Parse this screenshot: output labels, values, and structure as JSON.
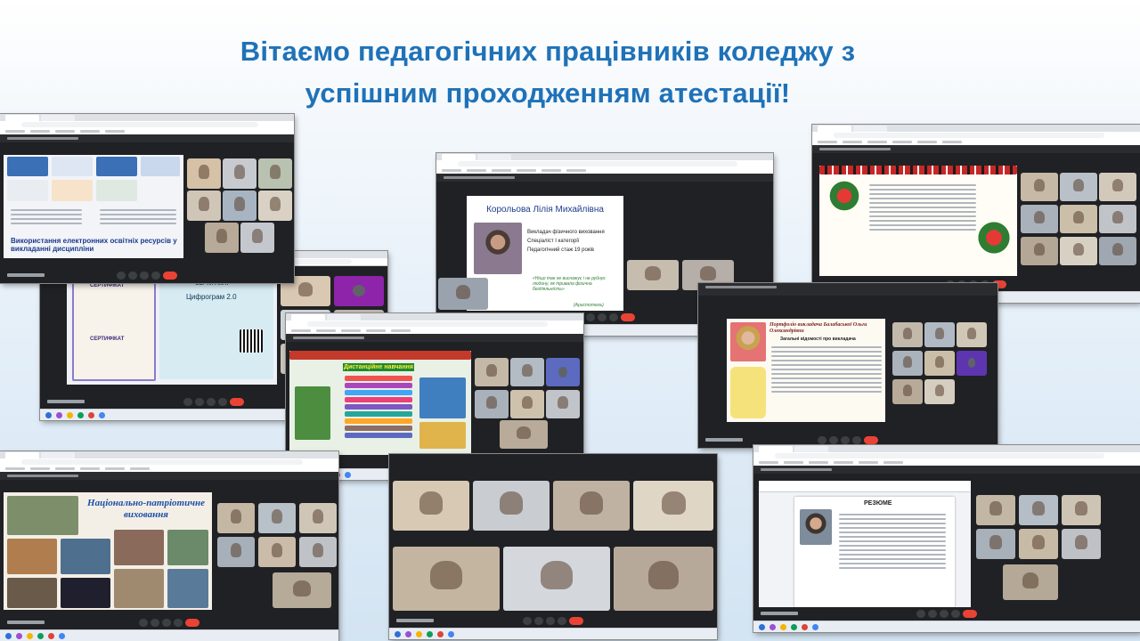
{
  "heading": {
    "line1": "Вітаємо педагогічних працівників коледжу з",
    "line2": "успішним проходженням атестації!"
  },
  "colors": {
    "heading": "#1f72b8",
    "meet_background": "#202124",
    "end_call": "#ea4335"
  },
  "screenshots": {
    "s1": {
      "slide_text": "Використання електронних освітніх ресурсів у викладанні дисципліни"
    },
    "s2": {
      "cert_label_1": "СЕРТИФІКАТ",
      "cert_label_2": "СЕРТИФІКАТ",
      "cert_label_3": "СЕРТИФІКАТ",
      "cert_title": "Цифрограм 2.0"
    },
    "s3": {
      "slide_title": "Корольова Лілія Михайлівна",
      "slide_lines": [
        "Викладач фізичного виховання",
        "Спеціаліст І категорії",
        "Педагогічний стаж 19 років"
      ],
      "motto": "«Ніщо так не виснажує і не руйнує людину, як тривала фізична бездіяльність»",
      "motto_author": "(Аристотель)"
    },
    "s5": {
      "slide_title": "Дистанційне навчання"
    },
    "s6": {
      "slide_title": "Портфоліо викладача Балабаської Ольги Олександрівни",
      "subtitle": "Загальні відомості про викладача"
    },
    "s7": {
      "slide_title": "Національно-патріотичне виховання"
    },
    "s9": {
      "slide_title": "РЕЗЮМЕ"
    }
  }
}
